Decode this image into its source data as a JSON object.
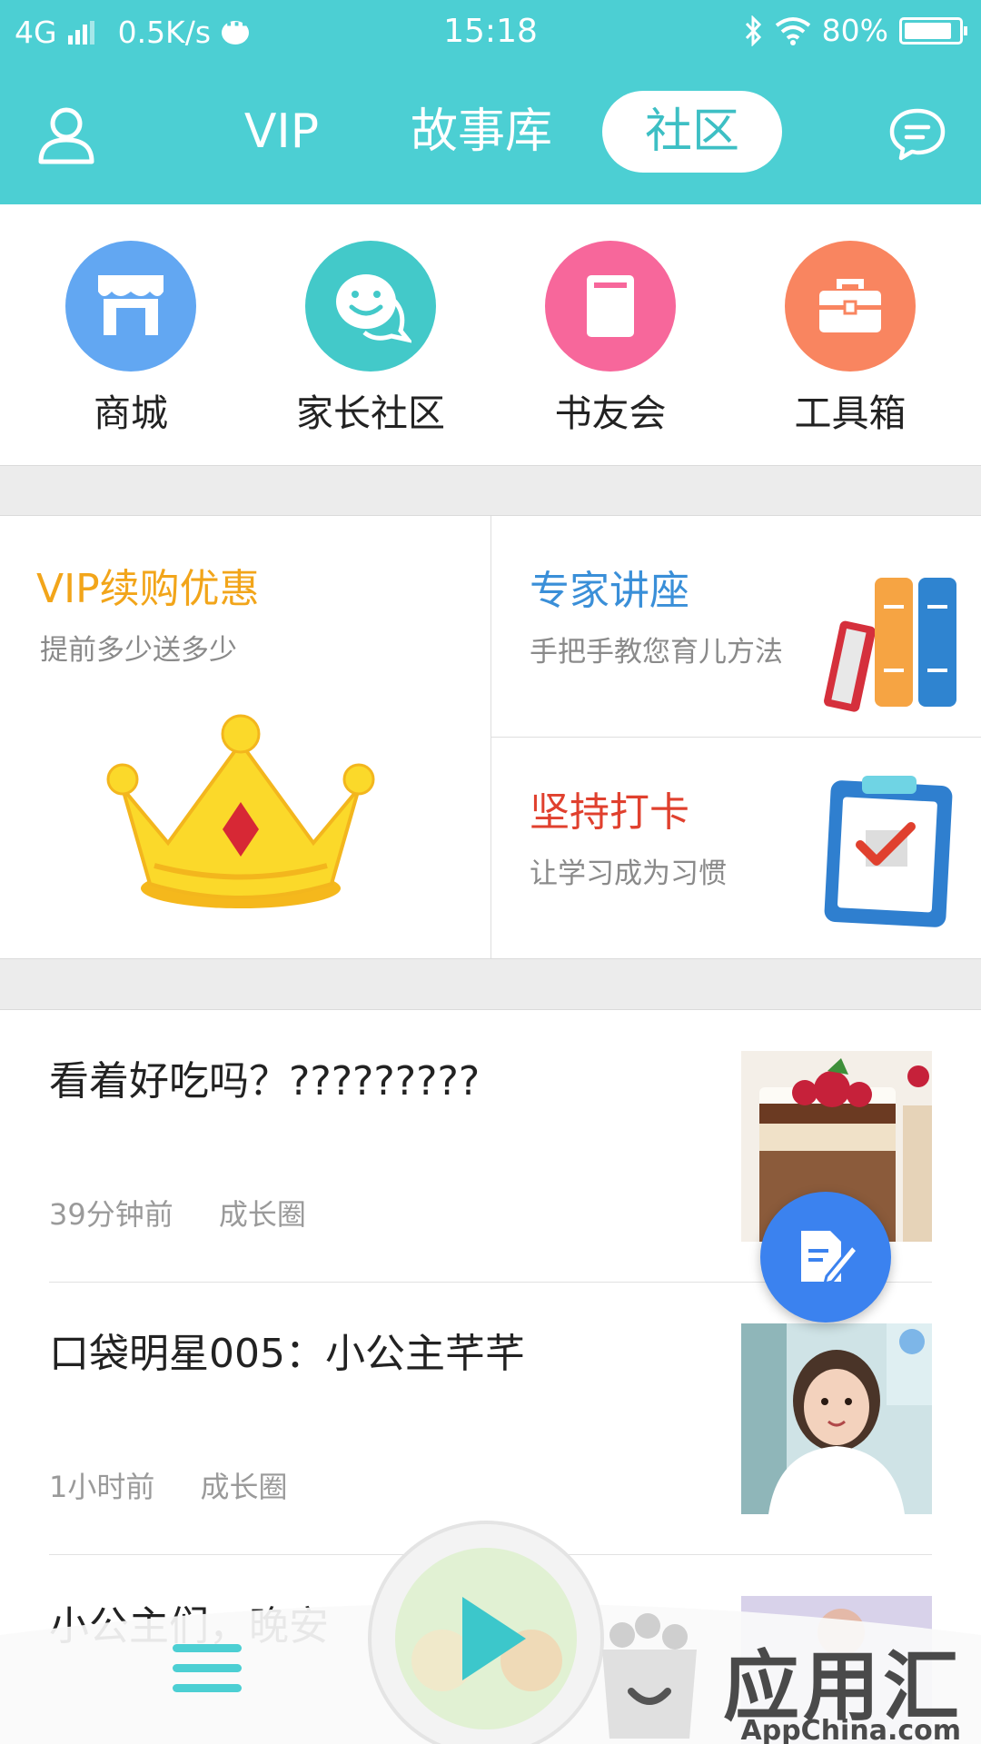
{
  "status_bar": {
    "network": "4G",
    "speed": "0.5K/s",
    "time": "15:18",
    "battery": "80%",
    "battery_level": 0.8
  },
  "header": {
    "tabs": [
      {
        "label": "VIP"
      },
      {
        "label": "故事库"
      },
      {
        "label": "社区"
      }
    ],
    "active_tab": "社区"
  },
  "quick_links": [
    {
      "label": "商城",
      "icon": "store-icon",
      "color": "#62a7f2"
    },
    {
      "label": "家长社区",
      "icon": "smiley-chat-icon",
      "color": "#43c9c9"
    },
    {
      "label": "书友会",
      "icon": "book-icon",
      "color": "#f7679b"
    },
    {
      "label": "工具箱",
      "icon": "toolbox-icon",
      "color": "#f98560"
    }
  ],
  "promos": {
    "vip": {
      "title": "VIP续购优惠",
      "subtitle": "提前多少送多少",
      "color": "#f2a51a"
    },
    "lecture": {
      "title": "专家讲座",
      "subtitle": "手把手教您育儿方法",
      "color": "#3a8fd8"
    },
    "checkin": {
      "title": "坚持打卡",
      "subtitle": "让学习成为习惯",
      "color": "#e0402e"
    }
  },
  "feed": [
    {
      "title": "看着好吃吗？?????????",
      "time": "39分钟前",
      "tag": "成长圈"
    },
    {
      "title": "口袋明星005：小公主芊芊",
      "time": "1小时前",
      "tag": "成长圈"
    },
    {
      "title": "小公主们，晚安",
      "time": "",
      "tag": ""
    }
  ],
  "watermark": {
    "title": "应用汇",
    "subtitle": "AppChina.com"
  }
}
